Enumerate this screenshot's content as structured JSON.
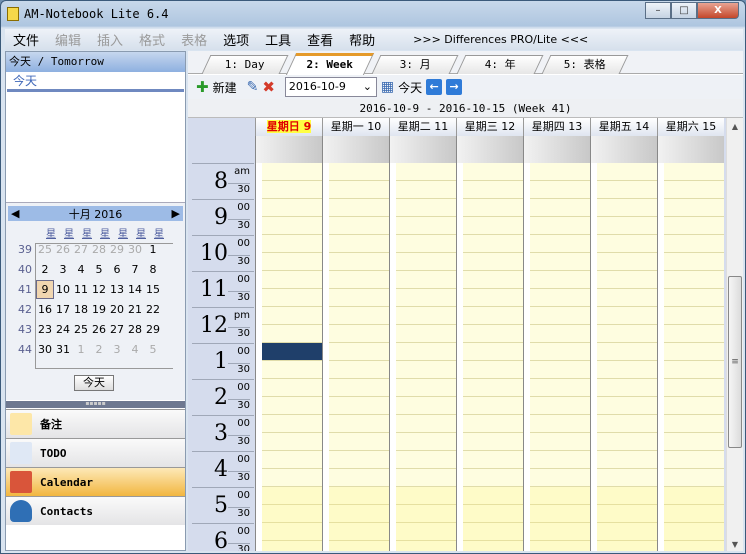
{
  "window": {
    "title": "AM-Notebook Lite  6.4",
    "min": "–",
    "max": "□",
    "close": "X"
  },
  "menu": [
    {
      "label": "文件",
      "enabled": true
    },
    {
      "label": "编辑",
      "enabled": false
    },
    {
      "label": "插入",
      "enabled": false
    },
    {
      "label": "格式",
      "enabled": false
    },
    {
      "label": "表格",
      "enabled": false
    },
    {
      "label": "选项",
      "enabled": true
    },
    {
      "label": "工具",
      "enabled": true
    },
    {
      "label": "查看",
      "enabled": true
    },
    {
      "label": "帮助",
      "enabled": true
    }
  ],
  "menu_link": ">>> Differences PRO/Lite <<<",
  "left": {
    "header": "今天 / Tomorrow",
    "item": "今天",
    "calendar": {
      "month": "十月 2016",
      "prev": "◀",
      "next": "▶",
      "weekday": "星",
      "weeks": [
        39,
        40,
        41,
        42,
        43,
        44
      ],
      "days": [
        [
          25,
          26,
          27,
          28,
          29,
          30,
          1
        ],
        [
          2,
          3,
          4,
          5,
          6,
          7,
          8
        ],
        [
          9,
          10,
          11,
          12,
          13,
          14,
          15
        ],
        [
          16,
          17,
          18,
          19,
          20,
          21,
          22
        ],
        [
          23,
          24,
          25,
          26,
          27,
          28,
          29
        ],
        [
          30,
          31,
          1,
          2,
          3,
          4,
          5
        ]
      ],
      "selected": "9",
      "today_button": "今天"
    },
    "nav": [
      {
        "label": "备注",
        "color": "#fde7a8"
      },
      {
        "label": "TODO",
        "color": "#dfe8f5"
      },
      {
        "label": "Calendar",
        "color": "#d9553a",
        "active": true
      },
      {
        "label": "Contacts",
        "color": "#2f6fb5"
      }
    ]
  },
  "tabs": [
    "1: Day",
    "2: Week",
    "3: 月",
    "4: 年",
    "5: 表格"
  ],
  "toolbar": {
    "new": "新建",
    "date": "2016-10-9",
    "today": "今天",
    "prev": "←",
    "next": "→"
  },
  "range": "2016-10-9  -  2016-10-15   (Week 41)",
  "days": [
    "星期日 9",
    "星期一 10",
    "星期二 11",
    "星期三 12",
    "星期四 13",
    "星期五 14",
    "星期六 15"
  ],
  "hours": [
    {
      "h": "8",
      "top": "am"
    },
    {
      "h": "9",
      "top": "00"
    },
    {
      "h": "10",
      "top": "00"
    },
    {
      "h": "11",
      "top": "00"
    },
    {
      "h": "12",
      "top": "pm"
    },
    {
      "h": "1",
      "top": "00"
    },
    {
      "h": "2",
      "top": "00"
    },
    {
      "h": "3",
      "top": "00"
    },
    {
      "h": "4",
      "top": "00"
    },
    {
      "h": "5",
      "top": "00"
    },
    {
      "h": "6",
      "top": "00"
    }
  ],
  "half": "30",
  "colors": {
    "slot": "#fefde0",
    "after_hours": "#fefbc8",
    "event": "#1f3f6a",
    "today_bg": "#ffff44",
    "today_fg": "#e00000"
  }
}
